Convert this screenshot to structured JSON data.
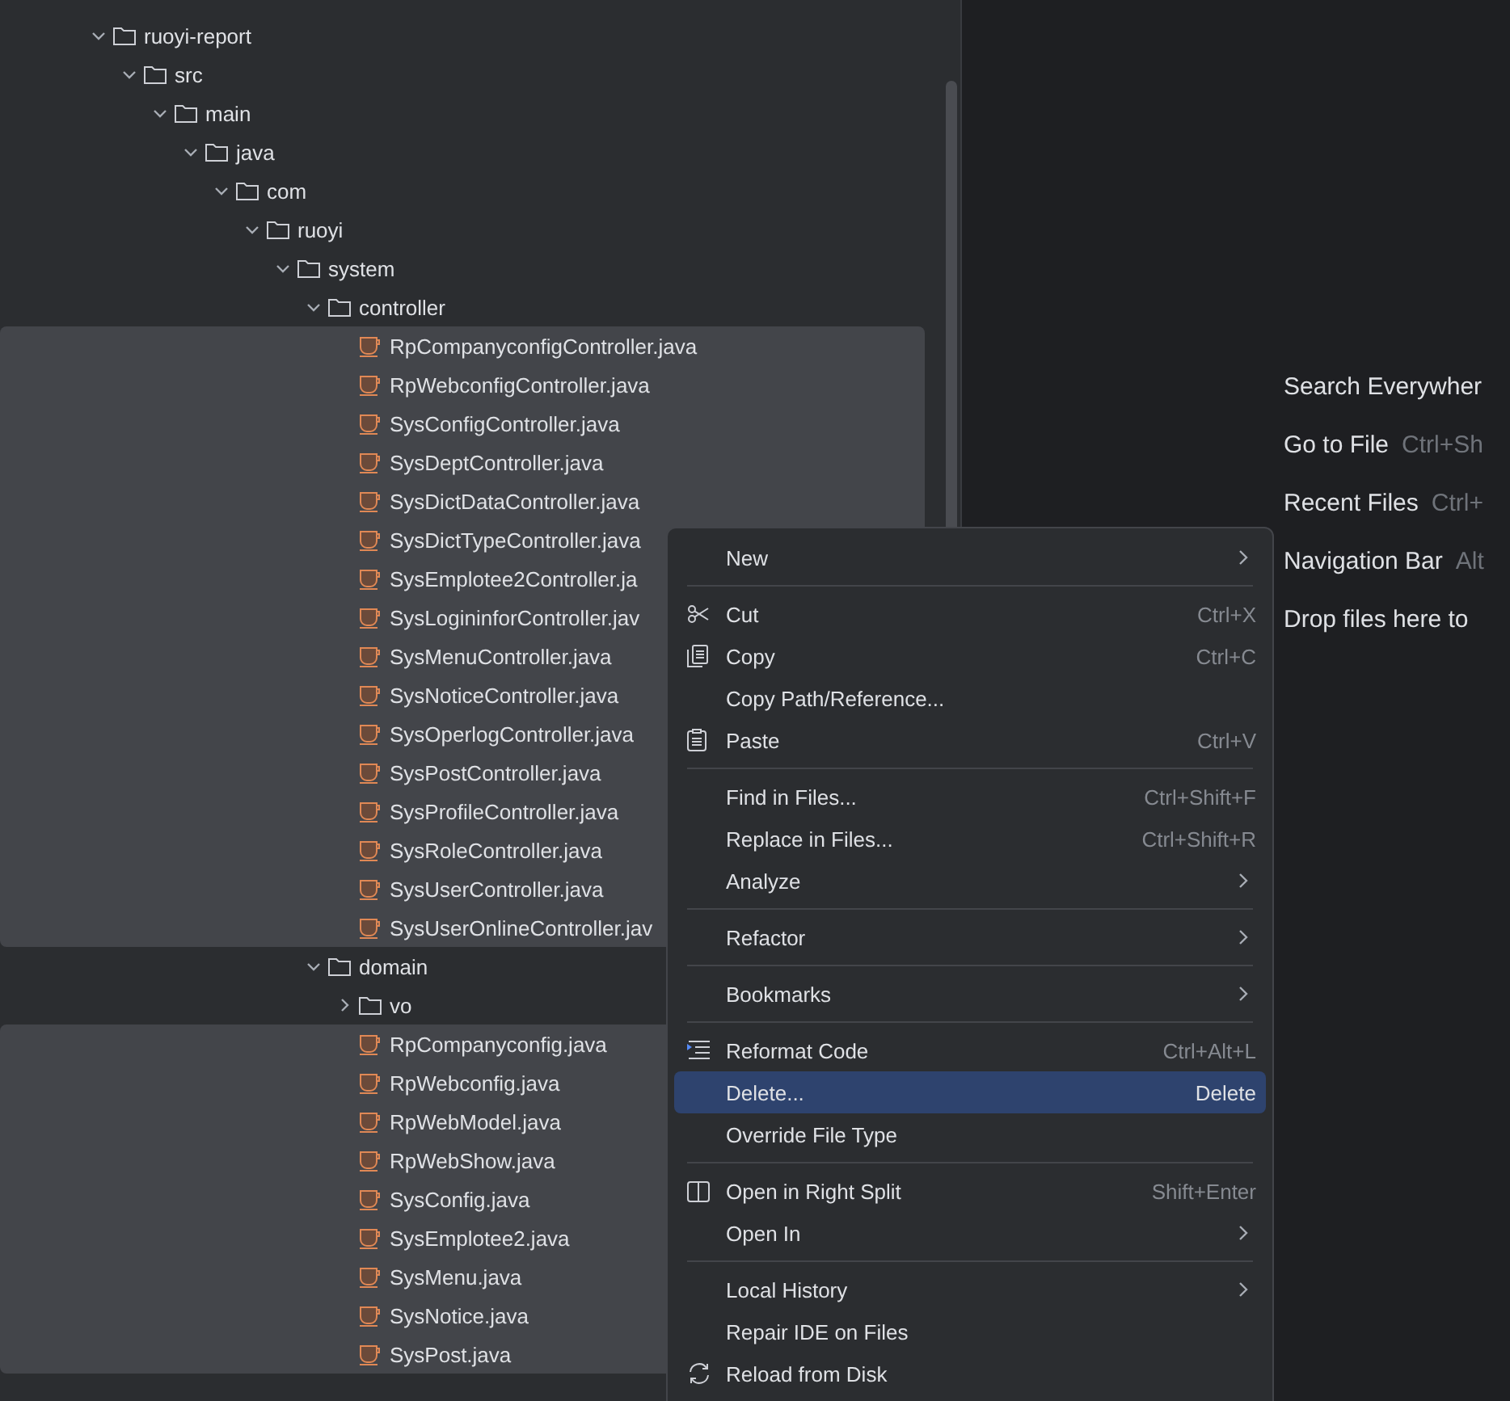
{
  "project_tree": [
    {
      "label": "ruoyi-report",
      "kind": "folder",
      "expanded": true,
      "selected": false,
      "children": [
        {
          "label": "src",
          "kind": "folder",
          "expanded": true,
          "selected": false,
          "children": [
            {
              "label": "main",
              "kind": "folder",
              "expanded": true,
              "selected": false,
              "children": [
                {
                  "label": "java",
                  "kind": "folder",
                  "expanded": true,
                  "selected": false,
                  "children": [
                    {
                      "label": "com",
                      "kind": "folder",
                      "expanded": true,
                      "selected": false,
                      "children": [
                        {
                          "label": "ruoyi",
                          "kind": "folder",
                          "expanded": true,
                          "selected": false,
                          "children": [
                            {
                              "label": "system",
                              "kind": "folder",
                              "expanded": true,
                              "selected": false,
                              "children": [
                                {
                                  "label": "controller",
                                  "kind": "folder",
                                  "expanded": true,
                                  "selected": false,
                                  "children": [
                                    {
                                      "label": "RpCompanyconfigController.java",
                                      "kind": "file",
                                      "selected": true
                                    },
                                    {
                                      "label": "RpWebconfigController.java",
                                      "kind": "file",
                                      "selected": true
                                    },
                                    {
                                      "label": "SysConfigController.java",
                                      "kind": "file",
                                      "selected": true
                                    },
                                    {
                                      "label": "SysDeptController.java",
                                      "kind": "file",
                                      "selected": true
                                    },
                                    {
                                      "label": "SysDictDataController.java",
                                      "kind": "file",
                                      "selected": true
                                    },
                                    {
                                      "label": "SysDictTypeController.java",
                                      "kind": "file",
                                      "selected": true
                                    },
                                    {
                                      "label": "SysEmplotee2Controller.ja",
                                      "kind": "file",
                                      "selected": true
                                    },
                                    {
                                      "label": "SysLogininforController.jav",
                                      "kind": "file",
                                      "selected": true
                                    },
                                    {
                                      "label": "SysMenuController.java",
                                      "kind": "file",
                                      "selected": true
                                    },
                                    {
                                      "label": "SysNoticeController.java",
                                      "kind": "file",
                                      "selected": true
                                    },
                                    {
                                      "label": "SysOperlogController.java",
                                      "kind": "file",
                                      "selected": true
                                    },
                                    {
                                      "label": "SysPostController.java",
                                      "kind": "file",
                                      "selected": true
                                    },
                                    {
                                      "label": "SysProfileController.java",
                                      "kind": "file",
                                      "selected": true
                                    },
                                    {
                                      "label": "SysRoleController.java",
                                      "kind": "file",
                                      "selected": true
                                    },
                                    {
                                      "label": "SysUserController.java",
                                      "kind": "file",
                                      "selected": true
                                    },
                                    {
                                      "label": "SysUserOnlineController.jav",
                                      "kind": "file",
                                      "selected": true
                                    }
                                  ]
                                },
                                {
                                  "label": "domain",
                                  "kind": "folder",
                                  "expanded": true,
                                  "selected": false,
                                  "children": [
                                    {
                                      "label": "vo",
                                      "kind": "folder",
                                      "expanded": false,
                                      "selected": false
                                    },
                                    {
                                      "label": "RpCompanyconfig.java",
                                      "kind": "file",
                                      "selected": true
                                    },
                                    {
                                      "label": "RpWebconfig.java",
                                      "kind": "file",
                                      "selected": true
                                    },
                                    {
                                      "label": "RpWebModel.java",
                                      "kind": "file",
                                      "selected": true
                                    },
                                    {
                                      "label": "RpWebShow.java",
                                      "kind": "file",
                                      "selected": true
                                    },
                                    {
                                      "label": "SysConfig.java",
                                      "kind": "file",
                                      "selected": true
                                    },
                                    {
                                      "label": "SysEmplotee2.java",
                                      "kind": "file",
                                      "selected": true
                                    },
                                    {
                                      "label": "SysMenu.java",
                                      "kind": "file",
                                      "selected": true
                                    },
                                    {
                                      "label": "SysNotice.java",
                                      "kind": "file",
                                      "selected": true
                                    },
                                    {
                                      "label": "SysPost.java",
                                      "kind": "file",
                                      "selected": true
                                    }
                                  ]
                                }
                              ]
                            }
                          ]
                        }
                      ]
                    }
                  ]
                }
              ]
            }
          ]
        }
      ]
    }
  ],
  "editor_hints": [
    {
      "action": "Search Everywher"
    },
    {
      "action": "Go to File",
      "shortcut": "Ctrl+Sh"
    },
    {
      "action": "Recent Files",
      "shortcut": "Ctrl+"
    },
    {
      "action": "Navigation Bar",
      "shortcut": "Alt"
    },
    {
      "action": "Drop files here to"
    }
  ],
  "context_menu": [
    {
      "kind": "plain",
      "label": "New",
      "submenu": true,
      "selected": false
    },
    {
      "kind": "separator"
    },
    {
      "kind": "cut",
      "label": "Cut",
      "shortcut": "Ctrl+X",
      "selected": false
    },
    {
      "kind": "copy",
      "label": "Copy",
      "shortcut": "Ctrl+C",
      "selected": false
    },
    {
      "kind": "plain",
      "label": "Copy Path/Reference...",
      "selected": false
    },
    {
      "kind": "paste",
      "label": "Paste",
      "shortcut": "Ctrl+V",
      "selected": false
    },
    {
      "kind": "separator"
    },
    {
      "kind": "plain",
      "label": "Find in Files...",
      "shortcut": "Ctrl+Shift+F",
      "selected": false
    },
    {
      "kind": "plain",
      "label": "Replace in Files...",
      "shortcut": "Ctrl+Shift+R",
      "selected": false
    },
    {
      "kind": "plain",
      "label": "Analyze",
      "submenu": true,
      "selected": false
    },
    {
      "kind": "separator"
    },
    {
      "kind": "plain",
      "label": "Refactor",
      "submenu": true,
      "selected": false
    },
    {
      "kind": "separator"
    },
    {
      "kind": "plain",
      "label": "Bookmarks",
      "submenu": true,
      "selected": false
    },
    {
      "kind": "separator"
    },
    {
      "kind": "reformat",
      "label": "Reformat Code",
      "shortcut": "Ctrl+Alt+L",
      "selected": false
    },
    {
      "kind": "plain",
      "label": "Delete...",
      "shortcut": "Delete",
      "selected": true
    },
    {
      "kind": "plain",
      "label": "Override File Type",
      "selected": false
    },
    {
      "kind": "separator"
    },
    {
      "kind": "split",
      "label": "Open in Right Split",
      "shortcut": "Shift+Enter",
      "selected": false
    },
    {
      "kind": "plain",
      "label": "Open In",
      "submenu": true,
      "selected": false
    },
    {
      "kind": "separator"
    },
    {
      "kind": "plain",
      "label": "Local History",
      "submenu": true,
      "selected": false
    },
    {
      "kind": "plain",
      "label": "Repair IDE on Files",
      "selected": false
    },
    {
      "kind": "reload",
      "label": "Reload from Disk",
      "selected": false
    }
  ]
}
